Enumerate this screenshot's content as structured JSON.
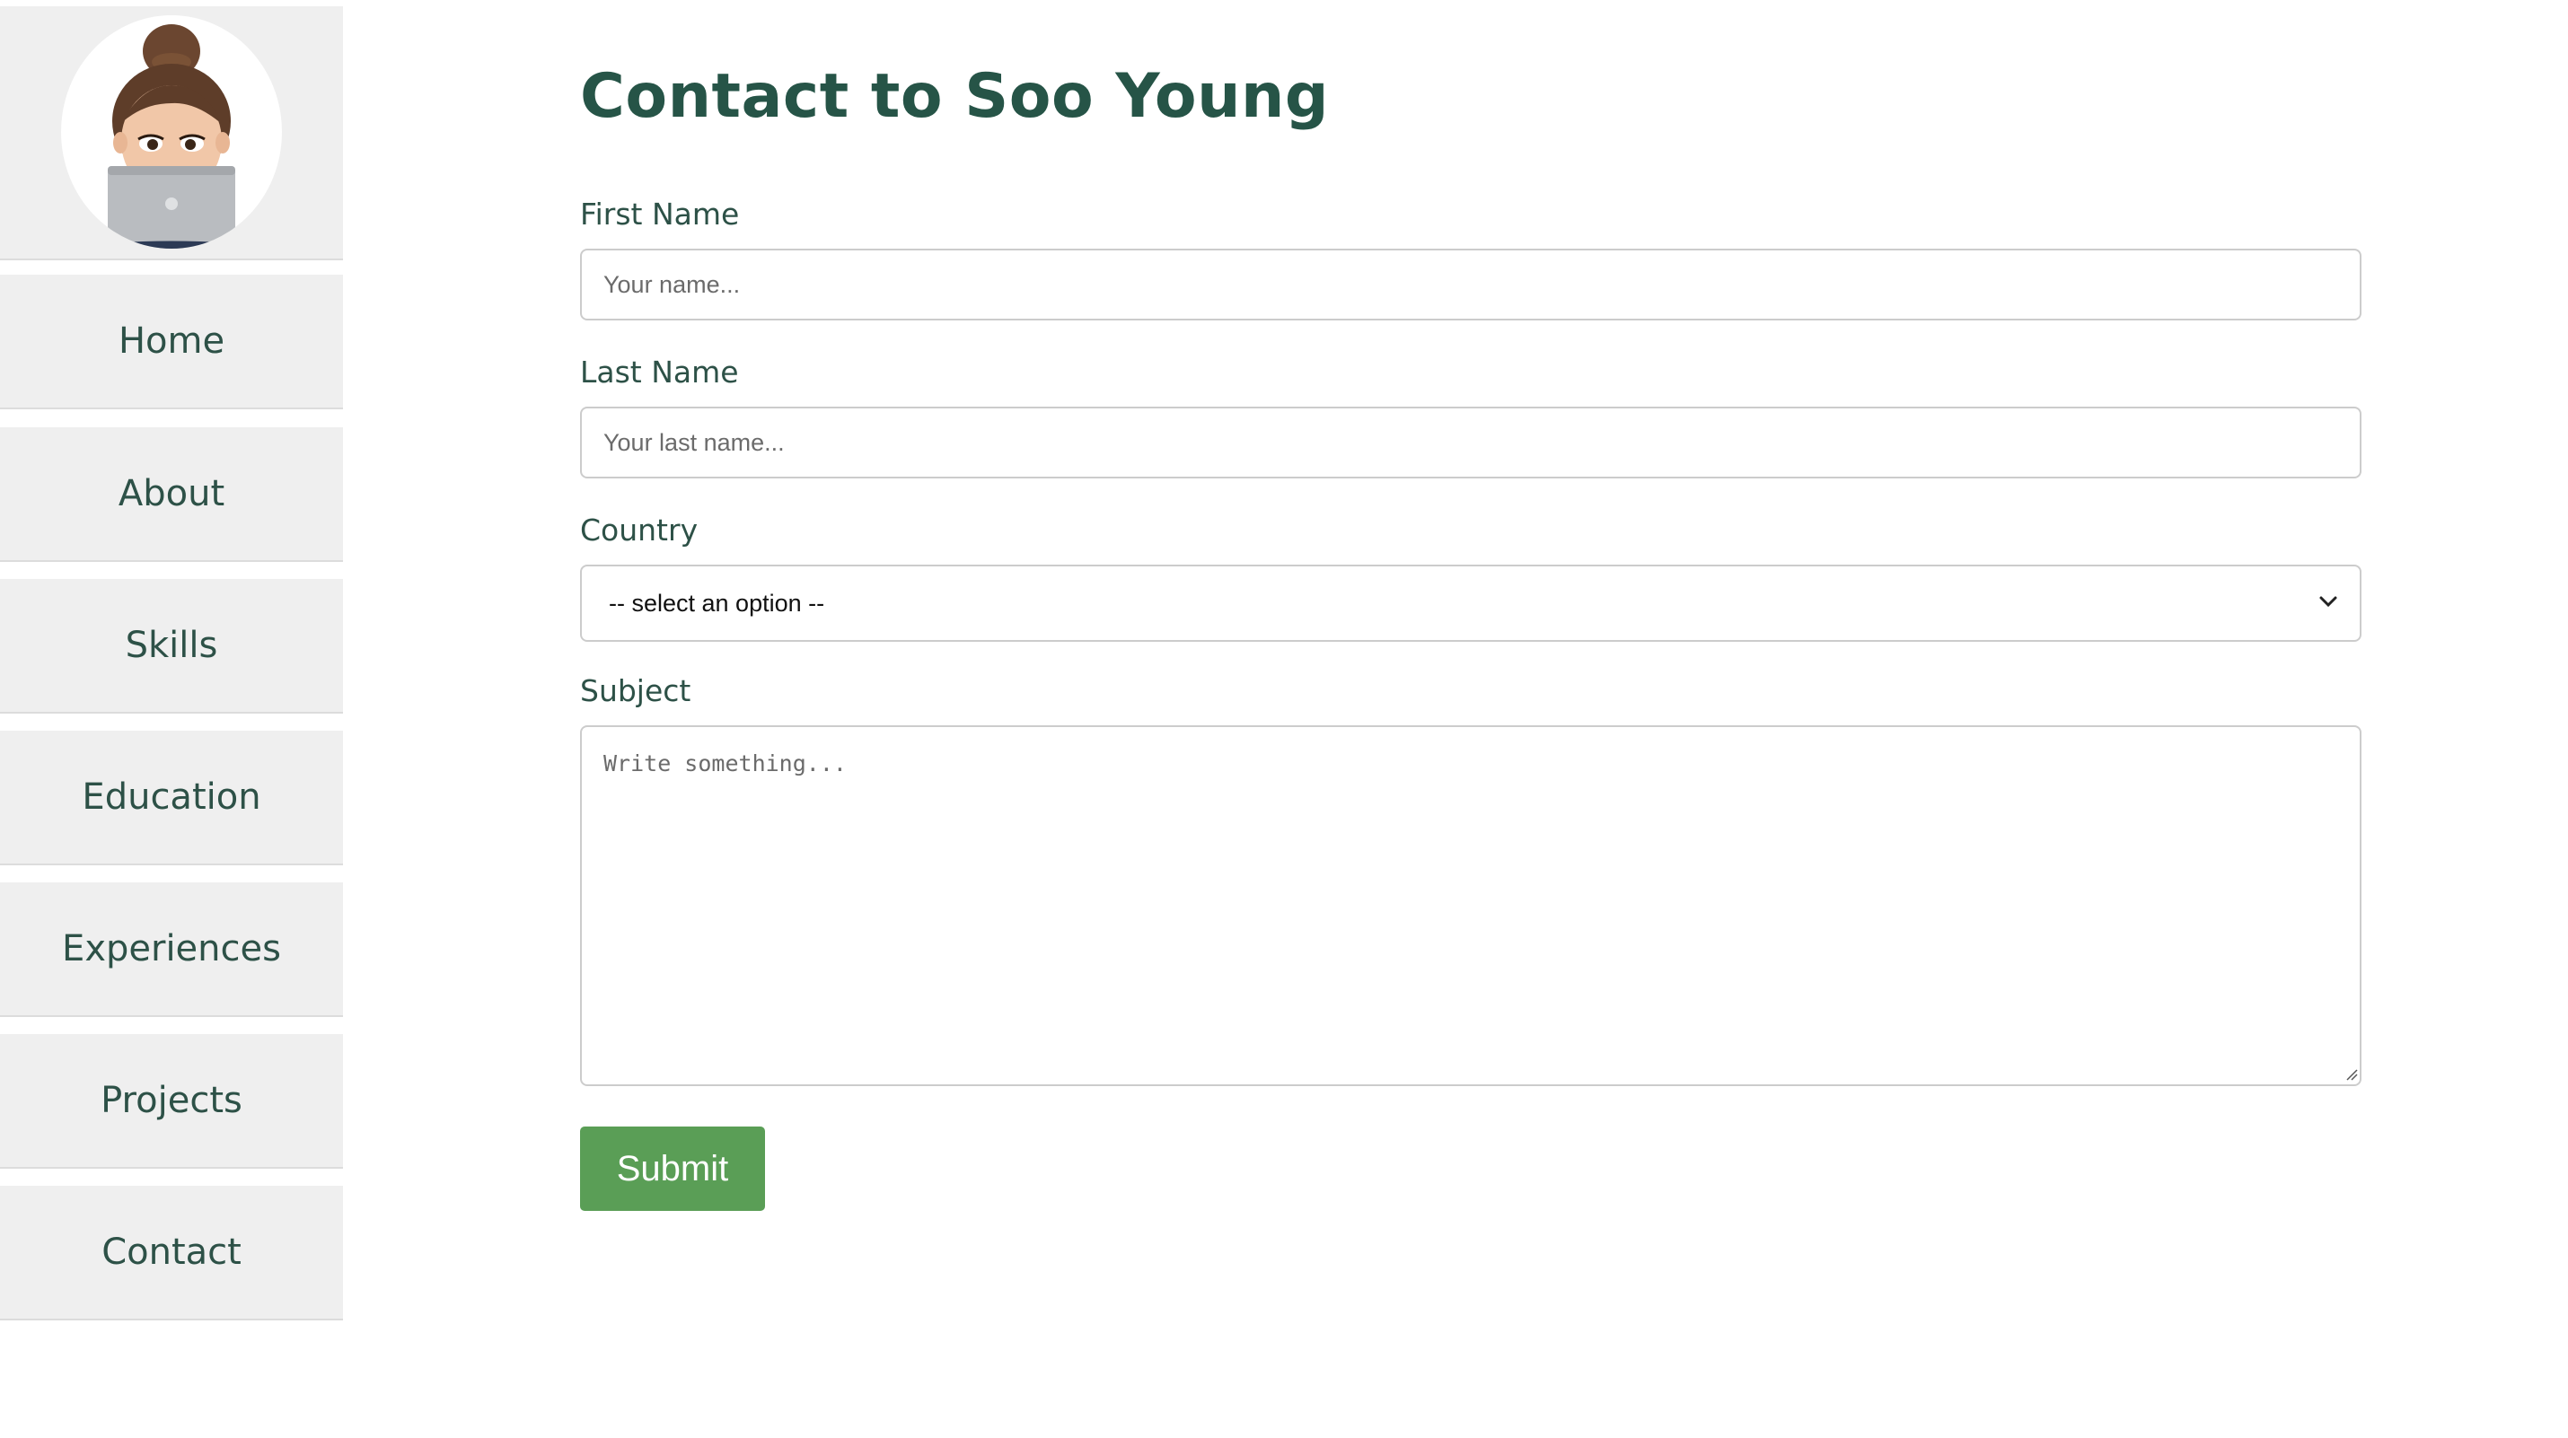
{
  "sidebar": {
    "avatar_icon": "memoji-laptop-avatar",
    "items": [
      {
        "label": "Home"
      },
      {
        "label": "About"
      },
      {
        "label": "Skills"
      },
      {
        "label": "Education"
      },
      {
        "label": "Experiences"
      },
      {
        "label": "Projects"
      },
      {
        "label": "Contact"
      }
    ]
  },
  "form": {
    "title": "Contact to Soo Young",
    "first_name": {
      "label": "First Name",
      "placeholder": "Your name...",
      "value": ""
    },
    "last_name": {
      "label": "Last Name",
      "placeholder": "Your last name...",
      "value": ""
    },
    "country": {
      "label": "Country",
      "selected": "-- select an option --"
    },
    "subject": {
      "label": "Subject",
      "placeholder": "Write something...",
      "value": ""
    },
    "submit_label": "Submit"
  },
  "colors": {
    "title": "#265447",
    "text": "#2d5147",
    "sidebar_bg": "#efefef",
    "button": "#5a9e56"
  }
}
